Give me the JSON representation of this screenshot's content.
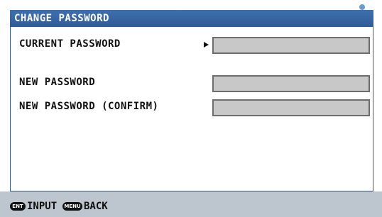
{
  "dialog": {
    "title": "CHANGE PASSWORD",
    "fields": {
      "current_password": {
        "label": "CURRENT PASSWORD",
        "value": ""
      },
      "new_password": {
        "label": "NEW PASSWORD",
        "value": ""
      },
      "new_password_confirm": {
        "label": "NEW PASSWORD (CONFIRM)",
        "value": ""
      }
    }
  },
  "footer": {
    "ent_key": "ENT",
    "ent_label": "INPUT",
    "menu_key": "MENU",
    "menu_label": "BACK"
  },
  "colors": {
    "title_bar": "#2f5c98",
    "field_fill": "#c8c8c8",
    "footer_bar": "#bdc6cf"
  }
}
